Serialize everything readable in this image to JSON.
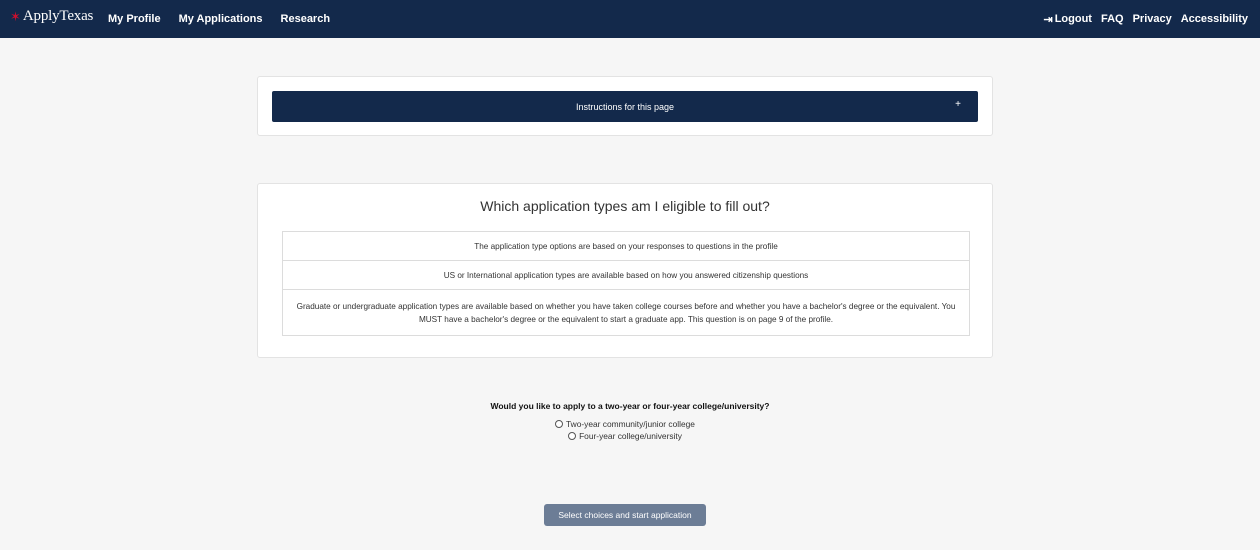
{
  "nav": {
    "brand_star": "✶",
    "brand_text": "ApplyTexas",
    "left_links": [
      "My Profile",
      "My Applications",
      "Research"
    ],
    "logout_label": "Logout",
    "right_links": [
      "FAQ",
      "Privacy",
      "Accessibility"
    ]
  },
  "instructions": {
    "label": "Instructions for this page",
    "toggle": "+"
  },
  "eligibility": {
    "title": "Which application types am I eligible to fill out?",
    "items": [
      "The application type options are based on your responses to questions in the profile",
      "US or International application types are available based on how you answered citizenship questions",
      "Graduate or undergraduate application types are available based on whether you have taken college courses before and whether you have a bachelor's degree or the equivalent. You MUST have a bachelor's degree or the equivalent to start a graduate app. This question is on page 9 of the profile."
    ]
  },
  "question": {
    "text": "Would you like to apply to a two-year or four-year college/university?",
    "options": [
      "Two-year community/junior college",
      "Four-year college/university"
    ]
  },
  "start_button": {
    "label": "Select choices and start application"
  },
  "colors": {
    "navy": "#13294b",
    "accent_red": "#c8102e",
    "button": "#6c7d96"
  }
}
